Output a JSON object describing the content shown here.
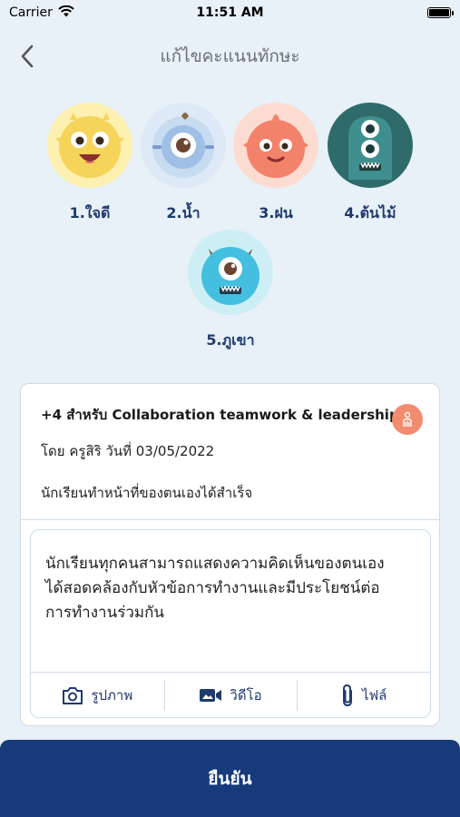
{
  "status_bar": {
    "carrier": "Carrier",
    "time": "11:51 AM"
  },
  "nav": {
    "title": "แก้ไขคะแนนทักษะ"
  },
  "avatars": [
    {
      "label": "1.ใจดี",
      "color": "#fdeea0"
    },
    {
      "label": "2.น้ำ",
      "color": "#d6e6f6"
    },
    {
      "label": "3.ฝน",
      "color": "#fcd8cc"
    },
    {
      "label": "4.ต้นไม้",
      "color": "#2f6b6b"
    },
    {
      "label": "5.ภูเขา",
      "color": "#cdeef4"
    }
  ],
  "card": {
    "title": "+4 สำหรับ Collaboration teamwork & leadership",
    "meta": "โดย ครูสิริ วันที่ 03/05/2022",
    "note": "นักเรียนทำหน้าที่ของตนเองได้สำเร็จ"
  },
  "comment": {
    "line1": "นักเรียนทุกคนสามารถแสดงความคิดเห็นของตนเอง",
    "line2": "ได้สอดคล้องกับหัวข้อการทำงานและมีประโยชน์ต่อ",
    "line3": "การทำงานร่วมกัน"
  },
  "attachments": {
    "photo": "รูปภาพ",
    "video": "วิดีโอ",
    "file": "ไฟล์"
  },
  "confirm_label": "ยืนยัน",
  "colors": {
    "primary": "#163a7a",
    "accent": "#f28c6e",
    "background": "#e8f0f8"
  }
}
